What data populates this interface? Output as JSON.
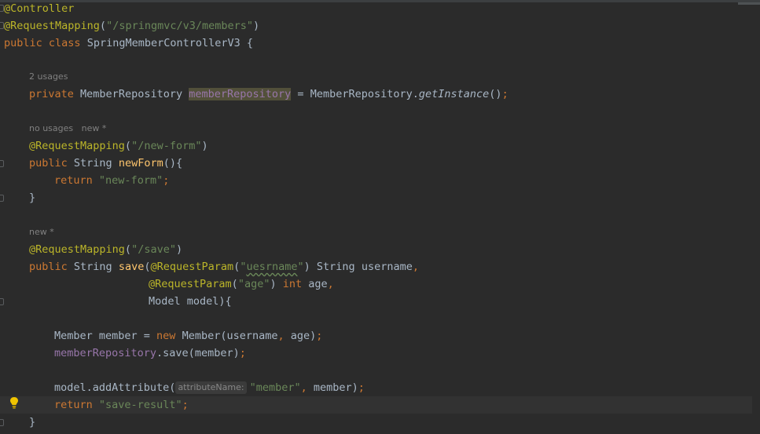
{
  "code": {
    "ann_controller": "@Controller",
    "ann_reqmap": "@RequestMapping",
    "path_members": "\"/springmvc/v3/members\"",
    "kw_public": "public",
    "kw_class": "class",
    "class_name": "SpringMemberControllerV3",
    "brace_open": "{",
    "usages_2": "2 usages",
    "kw_private": "private",
    "type_repo": "MemberRepository",
    "field_repo": "memberRepository",
    "assign": "=",
    "repo_class": "MemberRepository",
    "get_instance": "getInstance",
    "call_end": "();",
    "no_usages": "no usages   new *",
    "path_new_form": "\"/new-form\"",
    "type_string": "String",
    "method_new_form": "newForm",
    "paren_brace": "(){",
    "kw_return": "return",
    "str_new_form": "\"new-form\"",
    "semi": ";",
    "brace_close": "}",
    "new_star": "new *",
    "path_save": "\"/save\"",
    "method_save": "save",
    "ann_reqparam": "@RequestParam",
    "str_uesrname": "uesrname",
    "param_username": "username",
    "str_age": "\"age\"",
    "kw_int": "int",
    "param_age": "age",
    "model_decl": "Model model){",
    "member_decl": "Member member = ",
    "kw_new": "new",
    "member_ctor": "Member(username",
    "ctor_end": " age)",
    "repo_save_call": ".save(member)",
    "model_add": "model.addAttribute(",
    "hint_attr_name": "attributeName:",
    "str_member": "\"member\"",
    "arg_member": " member)",
    "str_save_result": "\"save-result\""
  },
  "colors": {
    "background": "#2b2b2b",
    "annotation": "#bbb529",
    "string": "#6a8759",
    "keyword": "#cc7832",
    "field": "#9876aa",
    "method_decl": "#ffc66d",
    "text": "#a9b7c6",
    "hint": "#808080"
  },
  "icons": [
    "fold-marker-icon",
    "lightbulb-icon"
  ]
}
